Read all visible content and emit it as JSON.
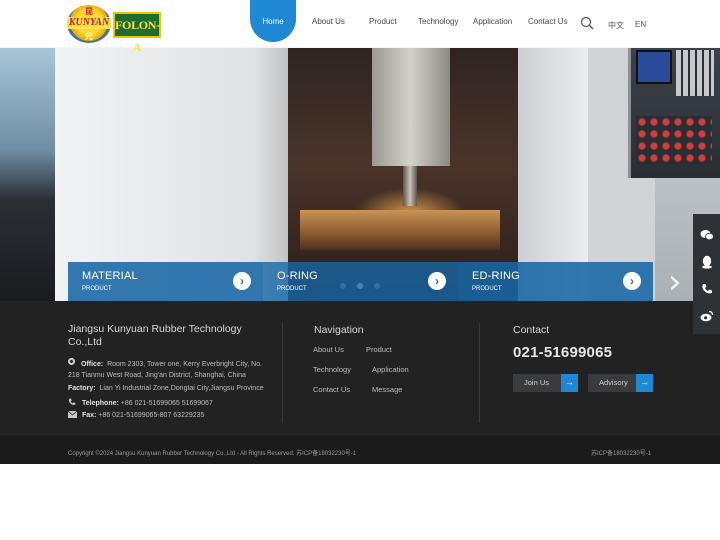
{
  "brand": {
    "logo_top": "昆",
    "logo_word": "KUNYAN",
    "logo_bottom": "元",
    "logo_box": "FOLON-A"
  },
  "nav": {
    "items": [
      {
        "label": "Home",
        "active": true
      },
      {
        "label": "About Us"
      },
      {
        "label": "Product"
      },
      {
        "label": "Technology"
      },
      {
        "label": "Application"
      },
      {
        "label": "Contact Us"
      }
    ],
    "lang_cn": "中文",
    "lang_en": "EN"
  },
  "hero": {
    "slide_count": 3,
    "active_slide": 2,
    "categories": [
      {
        "title": "MATERIAL",
        "subtitle": "PRODUCT",
        "color": "#1d6ca8"
      },
      {
        "title": "O-RING",
        "subtitle": "PRODUCT",
        "color": "#1d6ca8"
      },
      {
        "title": "ED-RING",
        "subtitle": "PRODUCT",
        "color": "#1d6ca8"
      }
    ],
    "next_arrow": "›"
  },
  "float": {
    "icons": [
      "wechat-icon",
      "qq-icon",
      "phone-icon",
      "weibo-icon"
    ]
  },
  "footer": {
    "company": "Jiangsu Kunyuan Rubber Technology Co.,Ltd",
    "office_label": "Office:",
    "office_value": "Room 2303, Tower one, Kerry Everbright City, No.",
    "office_value2": "218 Tianmu West Road, Jing'an District, Shanghai, China",
    "factory_label": "Factory:",
    "factory_value": "Lian Yi Industrial Zone,Dongtai City,Jiangsu Province",
    "telephone_label": "Telephone:",
    "telephone_value": "+86 021-51699065 51699067",
    "fax_label": "Fax:",
    "fax_value": "+86 021-51699065-807  63229235",
    "navigation_title": "Navigation",
    "links": [
      "About Us",
      "Product",
      "Technology",
      "Application",
      "Contact Us",
      "Message"
    ],
    "contact_title": "Contact",
    "contact_phone": "021-51699065",
    "join_label": "Join Us",
    "advisory_label": "Advisory",
    "button_arrow": "→",
    "accent": "#1e88d4"
  },
  "copyright": {
    "text": "Copyright ©2024 Jiangsu Kunyuan Rubber Technology Co.,Ltd - All Rights Reserved.  苏ICP备18032230号-1",
    "icp": "苏ICP备18032230号-1"
  }
}
